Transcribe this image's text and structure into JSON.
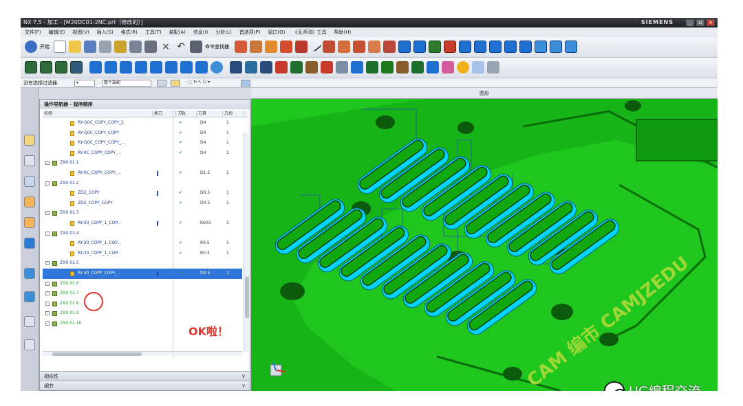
{
  "window": {
    "app_name": "NX 7.5",
    "title": "NX 7.5 - 加工 - [M20DC01-2NC.prt（修改的）]",
    "brand": "SIEMENS"
  },
  "menubar": [
    "文件(F)",
    "编辑(E)",
    "视图(V)",
    "插入(S)",
    "格式(R)",
    "工具(T)",
    "装配(A)",
    "信息(I)",
    "分析(L)",
    "首选项(P)",
    "窗口(O)",
    "《无浮动》工具",
    "帮助(H)"
  ],
  "toolbar1": {
    "start_label": "开始",
    "assembly_label": "命令查找器"
  },
  "filterbar": {
    "label": "没有选择过滤器",
    "assembly_select": "整个装配"
  },
  "viewport": {
    "title": "图形"
  },
  "navigator": {
    "title": "操作导航器 - 程序顺序",
    "columns": [
      "名称",
      "换刀",
      "刀轨",
      "刀具",
      "几何"
    ],
    "rows": [
      {
        "level": 3,
        "name": "RY-Q0C_COPY_COPY_2",
        "check": "✔",
        "tool": "D4",
        "num": "1"
      },
      {
        "level": 3,
        "name": "RY-Q0C_COPY_COPY",
        "check": "✔",
        "tool": "D4",
        "num": "1"
      },
      {
        "level": 3,
        "name": "RY-Q0C_COPY_COPY_...",
        "check": "✔",
        "tool": "D4",
        "num": "1"
      },
      {
        "level": 3,
        "name": "RY-0C_COPY_COPY_...",
        "check": "✔",
        "tool": "D4",
        "num": "1"
      },
      {
        "level": 2,
        "name": "ZXX 01.1",
        "group": true
      },
      {
        "level": 3,
        "name": "RY-0C_COPY_COPY_...",
        "bar": true,
        "check": "✔",
        "tool": "D1.5",
        "num": "1"
      },
      {
        "level": 2,
        "name": "ZXX 01.2",
        "group": true
      },
      {
        "level": 3,
        "name": "ZD2_COPY",
        "bar": true,
        "check": "✔",
        "tool": "D0.5",
        "num": "1"
      },
      {
        "level": 3,
        "name": "ZD2_COPY_COPY",
        "check": "✔",
        "tool": "D0.5",
        "num": "1"
      },
      {
        "level": 2,
        "name": "ZXX 01.3",
        "group": true
      },
      {
        "level": 3,
        "name": "RY-20_COPY_1_COP...",
        "bar": true,
        "check": "✔",
        "tool": "R603",
        "num": "1"
      },
      {
        "level": 2,
        "name": "ZXX 01.4",
        "group": true
      },
      {
        "level": 3,
        "name": "RY-20_COPY_1_COP...",
        "check": "✔",
        "tool": "R0.5",
        "num": "1"
      },
      {
        "level": 3,
        "name": "RY-20_COPY_1_COP...",
        "check": "✔",
        "tool": "R0.3",
        "num": "1"
      },
      {
        "level": 2,
        "name": "ZXX 01.5",
        "group": true
      },
      {
        "level": 3,
        "name": "RY-30_COPY_COPY_...",
        "selected": true,
        "bar": true,
        "check": "✔",
        "tool": "D0.5",
        "num": "1"
      },
      {
        "level": 2,
        "name": "ZXX 01.6",
        "group": true,
        "done": true
      },
      {
        "level": 2,
        "name": "ZXX 01.7",
        "group": true,
        "done": true
      },
      {
        "level": 2,
        "name": "ZXX 01.8",
        "group": true,
        "done": true
      },
      {
        "level": 2,
        "name": "ZXX 01.9",
        "group": true,
        "done": true
      },
      {
        "level": 2,
        "name": "ZXX 01.10",
        "group": true,
        "done": true
      }
    ],
    "annotation": "OK啦！",
    "subpanels": [
      "相依性",
      "细节"
    ]
  },
  "model": {
    "watermark": "CAM 编市 CAMJZEDU",
    "colors": {
      "background": "#1ec61e",
      "board": "#12a812",
      "dark": "#0a6b0a",
      "cyan": "#00d4ff",
      "hole": "#0c5a0c"
    }
  },
  "watermark": {
    "text": "UG编程交流"
  }
}
